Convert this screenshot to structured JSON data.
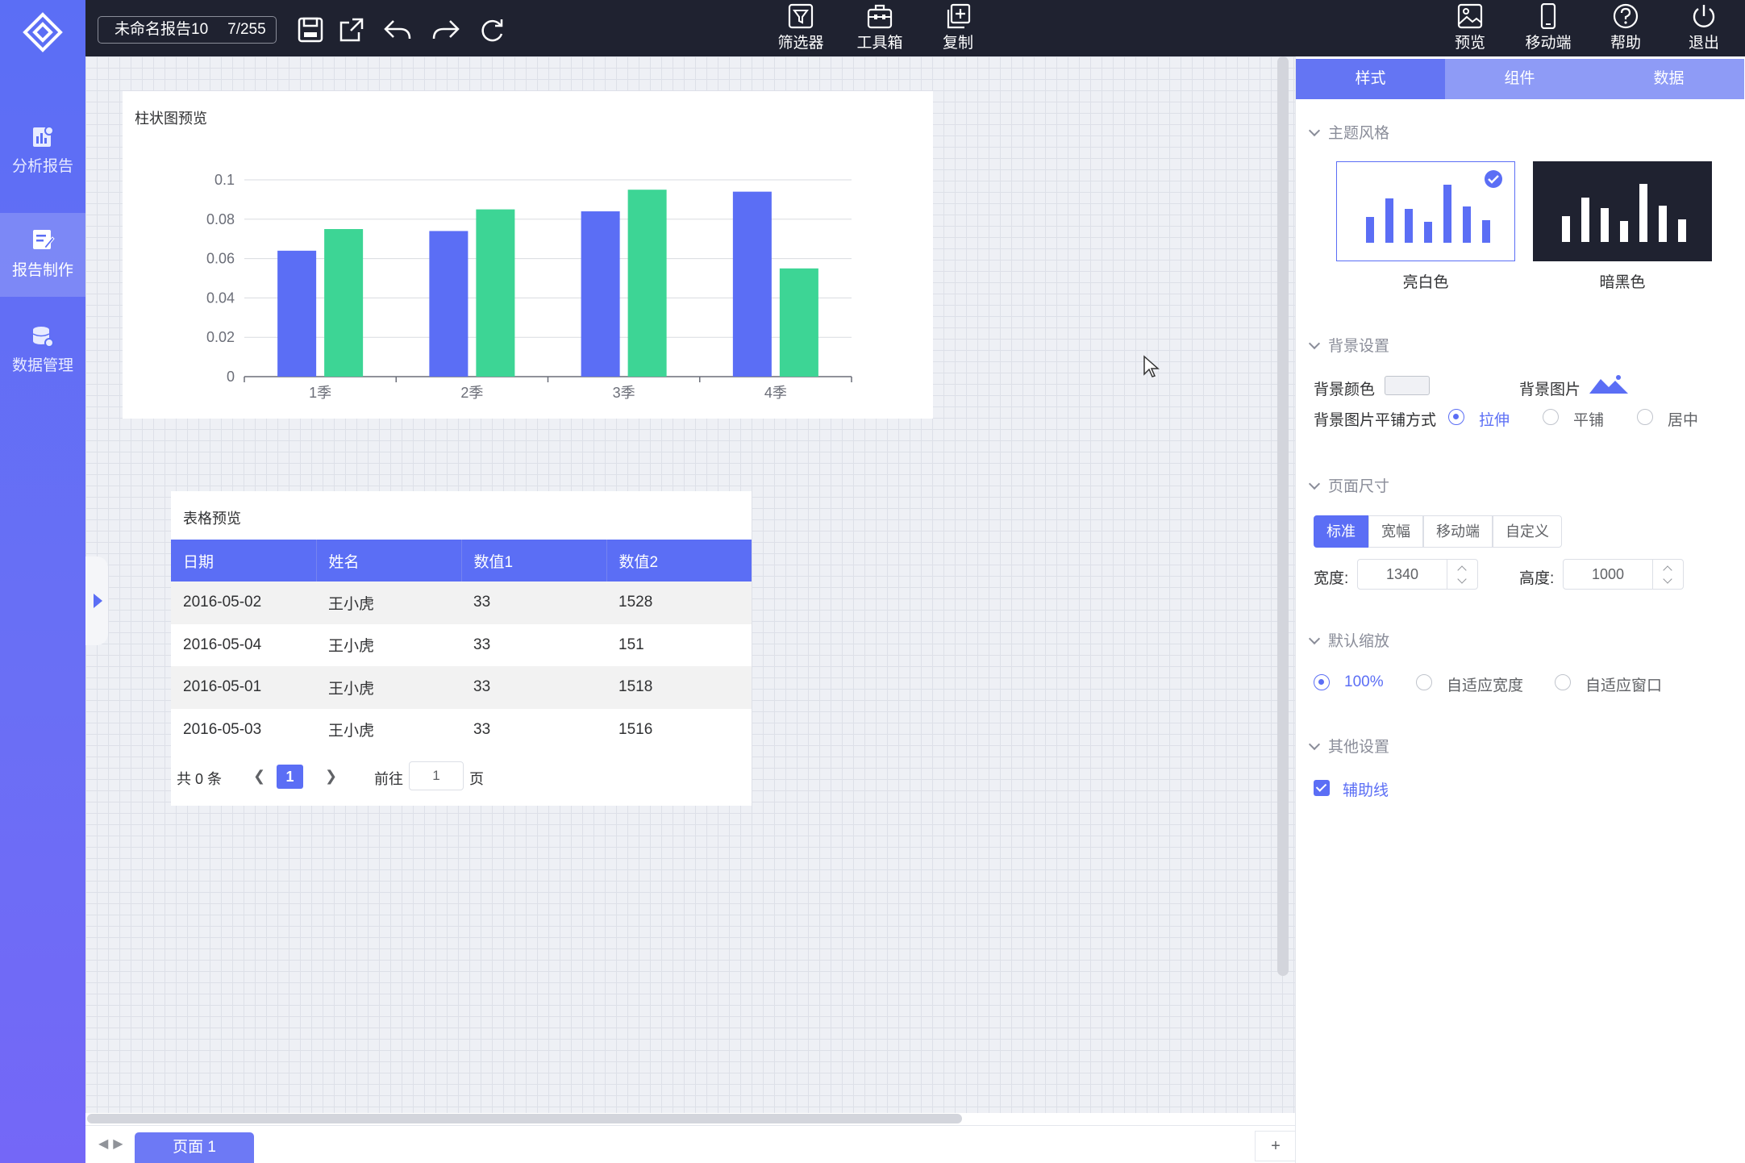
{
  "toolbar": {
    "doc_name": "未命名报告10",
    "doc_count": "7/255",
    "center_buttons": {
      "filter": "筛选器",
      "toolbox": "工具箱",
      "copy": "复制"
    },
    "right_buttons": {
      "preview": "预览",
      "mobile": "移动端",
      "help": "帮助",
      "exit": "退出"
    }
  },
  "sidebar": {
    "items": [
      {
        "label": "分析报告",
        "icon": "report-chart-icon"
      },
      {
        "label": "报告制作",
        "icon": "edit-doc-icon",
        "active": true
      },
      {
        "label": "数据管理",
        "icon": "database-gear-icon"
      }
    ]
  },
  "chart_card": {
    "title": "柱状图预览"
  },
  "chart_data": {
    "type": "bar",
    "categories": [
      "1季",
      "2季",
      "3季",
      "4季"
    ],
    "series": [
      {
        "color": "#5b6ef5",
        "values": [
          0.064,
          0.074,
          0.084,
          0.094
        ]
      },
      {
        "color": "#3dd595",
        "values": [
          0.075,
          0.085,
          0.095,
          0.055
        ]
      }
    ],
    "y_ticks": [
      "0",
      "0.02",
      "0.04",
      "0.06",
      "0.08",
      "0.1"
    ],
    "ylim": [
      0,
      0.1
    ],
    "grid": true
  },
  "table_card": {
    "title": "表格预览",
    "columns": [
      "日期",
      "姓名",
      "数值1",
      "数值2"
    ],
    "rows": [
      [
        "2016-05-02",
        "王小虎",
        "33",
        "1528"
      ],
      [
        "2016-05-04",
        "王小虎",
        "33",
        "151"
      ],
      [
        "2016-05-01",
        "王小虎",
        "33",
        "1518"
      ],
      [
        "2016-05-03",
        "王小虎",
        "33",
        "1516"
      ]
    ],
    "pager": {
      "total": "共 0 条",
      "current_page": "1",
      "goto_label": "前往",
      "goto_value": "1",
      "page_suffix": "页"
    }
  },
  "bottom": {
    "page_tab": "页面 1",
    "add": "+"
  },
  "panel": {
    "tabs": [
      "样式",
      "组件",
      "数据"
    ],
    "theme": {
      "heading": "主题风格",
      "light_label": "亮白色",
      "dark_label": "暗黑色",
      "selected": "亮白色"
    },
    "background": {
      "heading": "背景设置",
      "color_label": "背景颜色",
      "image_label": "背景图片",
      "tile_label": "背景图片平铺方式",
      "tile_options": [
        "拉伸",
        "平铺",
        "居中"
      ],
      "tile_selected": "拉伸"
    },
    "page_size": {
      "heading": "页面尺寸",
      "options": [
        "标准",
        "宽幅",
        "移动端",
        "自定义"
      ],
      "selected": "标准",
      "width_label": "宽度:",
      "width_value": "1340",
      "height_label": "高度:",
      "height_value": "1000"
    },
    "zoom": {
      "heading": "默认缩放",
      "options": [
        "100%",
        "自适应宽度",
        "自适应窗口"
      ],
      "selected": "100%"
    },
    "other": {
      "heading": "其他设置",
      "guide_label": "辅助线",
      "guide_checked": true
    },
    "colors": {
      "accent": "#5b6ef5",
      "green": "#3dd595",
      "dark": "#1f2230"
    }
  }
}
